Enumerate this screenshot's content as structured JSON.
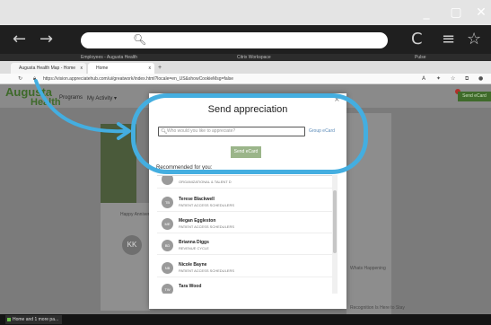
{
  "outer_browser": {
    "window_controls": {
      "minimize": "_",
      "maximize": "▢",
      "close": "✕"
    },
    "nav": {
      "back": "←",
      "forward": "→",
      "refresh": "C",
      "menu": "≡",
      "favorite": "☆"
    }
  },
  "citrix_bar": {
    "left_label": "Employees - Augusta Health",
    "center_label": "Citrix Workspace",
    "right_label": "Pulse"
  },
  "inner_browser": {
    "tabs": [
      {
        "label": "Augusta Health Map - Home",
        "close": "x"
      },
      {
        "label": "Home",
        "close": "x"
      }
    ],
    "new_tab": "+",
    "url": "https://vision.appreciatehub.com/ui/greatwork/index.html?locale=en_US&showCookieMsg=false"
  },
  "site": {
    "logo_line1": "Augusta",
    "logo_line2": "Health",
    "nav_items": [
      "Programs",
      "My Activity ▾"
    ],
    "action_button": "Send eCard",
    "left_card_text": "Happy Anniversary",
    "avatar_initials": "KK",
    "right_panel_lines": [
      "Whats Happening",
      "Recognition Is Here to Stay"
    ]
  },
  "modal": {
    "close": "×",
    "title": "Send appreciation",
    "search_placeholder": "Who would you like to appreciate?",
    "group_link": "Group eCard",
    "send_button": "Send eCard",
    "recommended_label": "Recommended for you:",
    "recommendations": [
      {
        "initials": "",
        "name": "",
        "dept": "ORGANIZATIONAL & TALENT D"
      },
      {
        "initials": "TB",
        "name": "Terese Blackwell",
        "dept": "PATIENT ACCESS SCHEDULERS"
      },
      {
        "initials": "ME",
        "name": "Megan Eggleston",
        "dept": "PATIENT ACCESS SCHEDULERS"
      },
      {
        "initials": "BD",
        "name": "Brianna Diggs",
        "dept": "REVENUE CYCLE"
      },
      {
        "initials": "NB",
        "name": "Nicole Bayne",
        "dept": "PATIENT ACCESS SCHEDULERS"
      },
      {
        "initials": "TW",
        "name": "Tara Wood",
        "dept": ""
      }
    ]
  },
  "taskbar": {
    "item_label": "Home and 1 more pa..."
  },
  "colors": {
    "highlight": "#44aee0",
    "brand_green": "#3f6b2a",
    "send_button": "#9bb58a"
  }
}
